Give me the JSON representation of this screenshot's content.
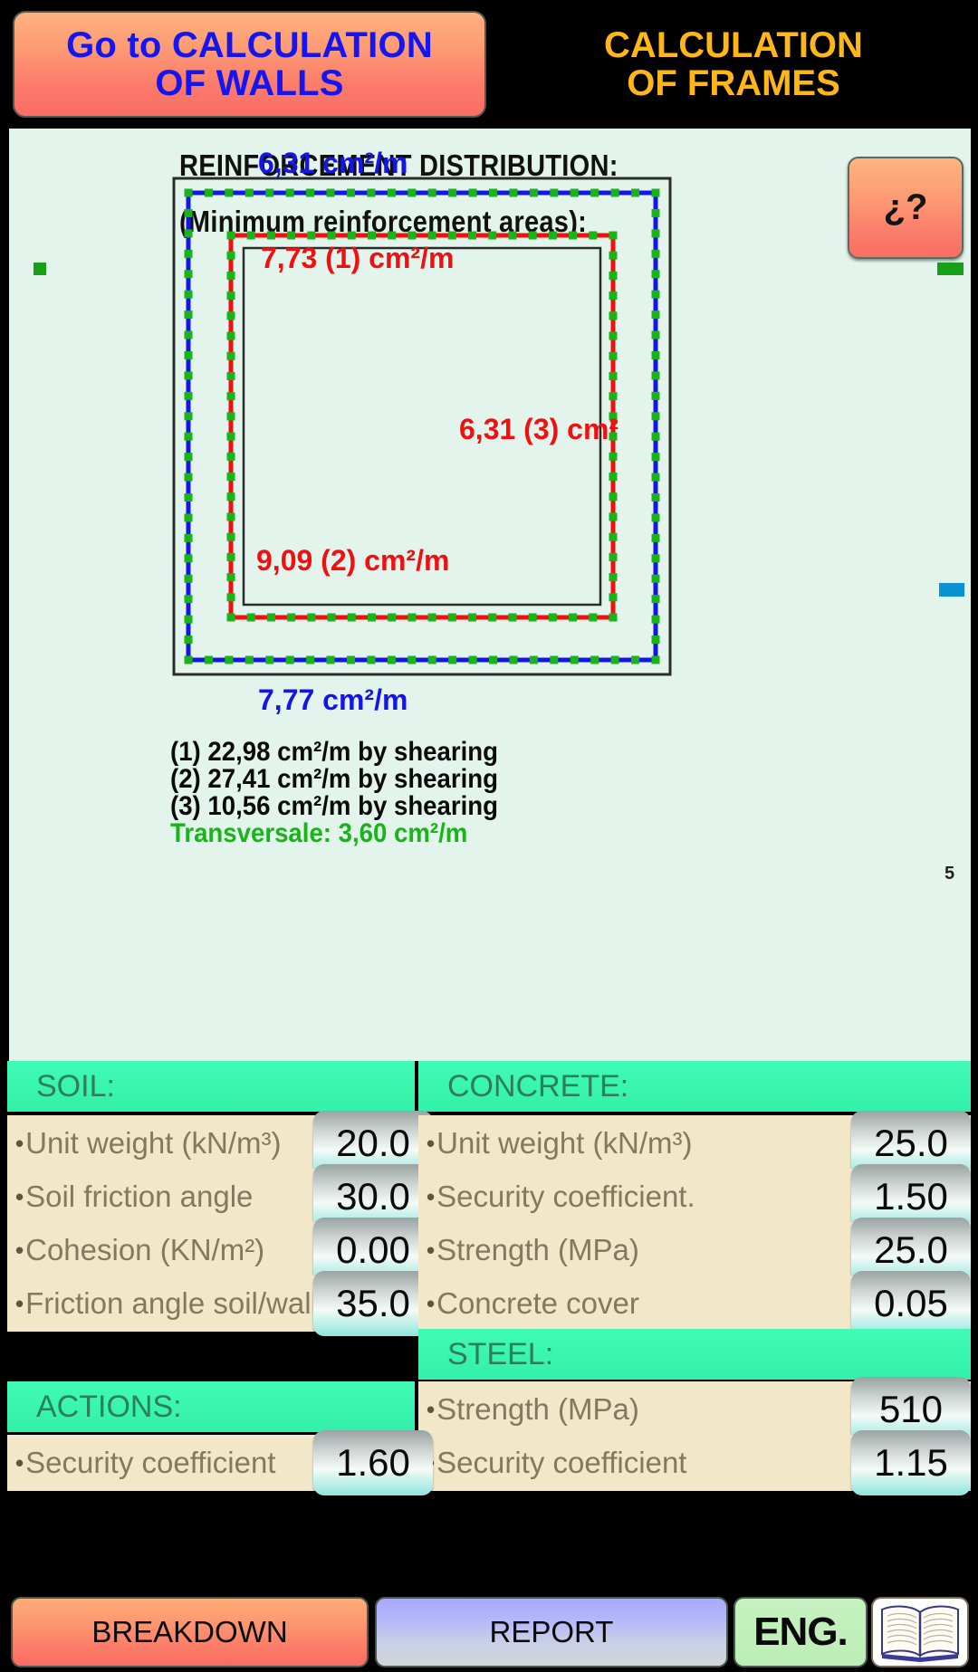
{
  "topbar": {
    "goto_button": {
      "line1": "Go to CALCULATION",
      "line2": "OF WALLS"
    },
    "title": {
      "line1": "CALCULATION",
      "line2": "OF FRAMES"
    }
  },
  "panel": {
    "heading_line1": "REINFORCEMENT DISTRIBUTION:",
    "heading_line2": "(Minimum reinforcement areas):",
    "help_button_label": "¿?",
    "clipped_glyph": "5"
  },
  "diagram": {
    "top_label": "6,31 cm²/m",
    "inner_top_label": "7,73 (1) cm²/m",
    "inner_right_label": "6,31 (3) cm²",
    "inner_bottom_label": "9,09 (2) cm²/m",
    "bottom_label": "7,77 cm²/m",
    "notes": [
      "(1) 22,98 cm²/m by shearing",
      "(2) 27,41 cm²/m by shearing",
      "(3) 10,56 cm²/m by shearing"
    ],
    "transversal_note": "Transversale: 3,60 cm²/m",
    "colors": {
      "outer_rebar": "#1515e8",
      "inner_rebar": "#f01010",
      "stirrup_dots": "#18b418",
      "frame": "#2b2b2b",
      "panel_bg": "#e2f4ec"
    }
  },
  "tables": {
    "soil": {
      "header": "SOIL:",
      "rows": [
        {
          "label": "Unit weight (kN/m³)",
          "value": "20.0"
        },
        {
          "label": "Soil friction angle",
          "value": "30.0"
        },
        {
          "label": "Cohesion (KN/m²)",
          "value": "0.00"
        },
        {
          "label": "Friction angle soil/wall",
          "value": "35.0"
        }
      ]
    },
    "concrete": {
      "header": "CONCRETE:",
      "rows": [
        {
          "label": "Unit weight (kN/m³)",
          "value": "25.0"
        },
        {
          "label": "Security coefficient.",
          "value": "1.50"
        },
        {
          "label": "Strength (MPa)",
          "value": "25.0"
        },
        {
          "label": "Concrete cover",
          "value": "0.05"
        }
      ]
    },
    "steel": {
      "header": "STEEL:",
      "rows": [
        {
          "label": "Strength (MPa)",
          "value": "510"
        },
        {
          "label": "Security coefficient",
          "value": "1.15"
        }
      ]
    },
    "actions": {
      "header": "ACTIONS:",
      "rows": [
        {
          "label": "Security coefficient",
          "value": "1.60"
        }
      ]
    }
  },
  "footer": {
    "breakdown_label": "BREAKDOWN",
    "report_label": "REPORT",
    "lang_label": "ENG.",
    "book_icon": "open-book-icon"
  }
}
